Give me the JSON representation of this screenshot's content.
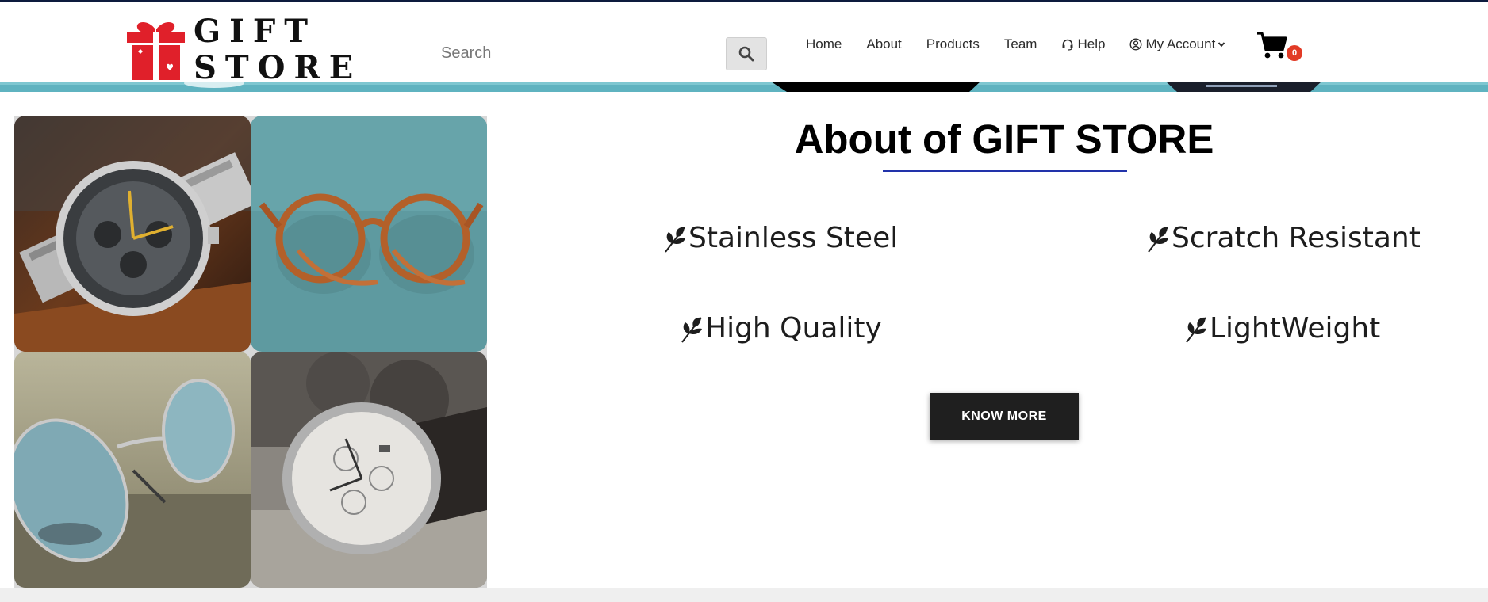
{
  "header": {
    "logo": {
      "line1": "GIFT",
      "line2": "STORE"
    },
    "search": {
      "placeholder": "Search",
      "value": ""
    },
    "nav": {
      "home": "Home",
      "about": "About",
      "products": "Products",
      "team": "Team",
      "help": "Help",
      "my_account": "My Account"
    },
    "cart": {
      "count": "0"
    }
  },
  "about": {
    "title": "About of GIFT STORE",
    "features": {
      "f1": "Stainless Steel",
      "f2": "Scratch Resistant",
      "f3": "High Quality",
      "f4": "LightWeight"
    },
    "button": "KNOW MORE"
  },
  "colors": {
    "accent_line": "#2233aa",
    "logo_red": "#e0202a",
    "badge": "#e23b26",
    "button_bg": "#1f1f1f",
    "top_line": "#0d1b3e"
  },
  "icons": [
    "gift-box-icon",
    "search-icon",
    "headset-icon",
    "user-circle-icon",
    "chevron-down-icon",
    "cart-icon",
    "leaf-icon"
  ]
}
